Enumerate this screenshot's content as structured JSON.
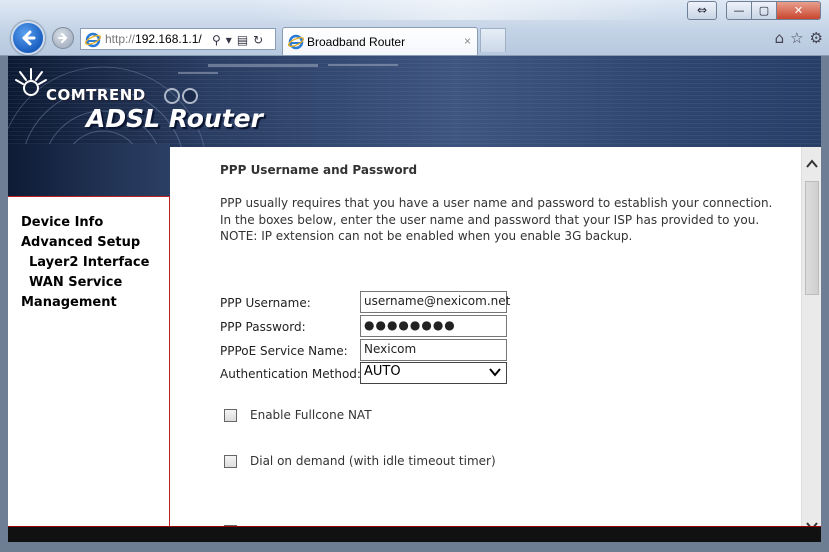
{
  "browser": {
    "url_prefix": "http://",
    "url_host": "192.168.1.1/",
    "tab_title": "Broadband Router",
    "tab_close": "×",
    "win_resize": "⇔",
    "win_minimize": "—",
    "win_maximize": "▢",
    "win_close": "✕",
    "icons": [
      "back-icon",
      "forward-icon",
      "search-icon",
      "dropdown-icon",
      "compatibility-icon",
      "refresh-icon",
      "home-icon",
      "favorites-star-icon",
      "settings-gear-icon"
    ]
  },
  "banner": {
    "logo_text": "COMTREND",
    "product_text": "ADSL Router"
  },
  "sidebar": {
    "items": [
      {
        "label": "Device Info"
      },
      {
        "label": "Advanced Setup"
      },
      {
        "label": "Layer2 Interface"
      },
      {
        "label": "WAN Service"
      },
      {
        "label": "Management"
      }
    ]
  },
  "content": {
    "title": "PPP Username and Password",
    "intro": "PPP usually requires that you have a user name and password to establish your connection. In the boxes below, enter the user name and password that your ISP has provided to you.",
    "note": "NOTE: IP extension can not be enabled when you enable 3G backup.",
    "form": {
      "username_label": "PPP Username:",
      "username_value": "username@nexicom.net",
      "password_label": "PPP Password:",
      "password_value": "●●●●●●●●",
      "service_label": "PPPoE Service Name:",
      "service_value": "Nexicom",
      "auth_label": "Authentication Method:",
      "auth_value": "AUTO"
    },
    "checkboxes": [
      {
        "label": "Enable Fullcone NAT",
        "checked": false
      },
      {
        "label": "Dial on demand (with idle timeout timer)",
        "checked": false
      }
    ]
  },
  "colors": {
    "accent_red": "#bb2222",
    "banner_dark": "#0d1a33",
    "ie_blue": "#1a5fc0"
  }
}
